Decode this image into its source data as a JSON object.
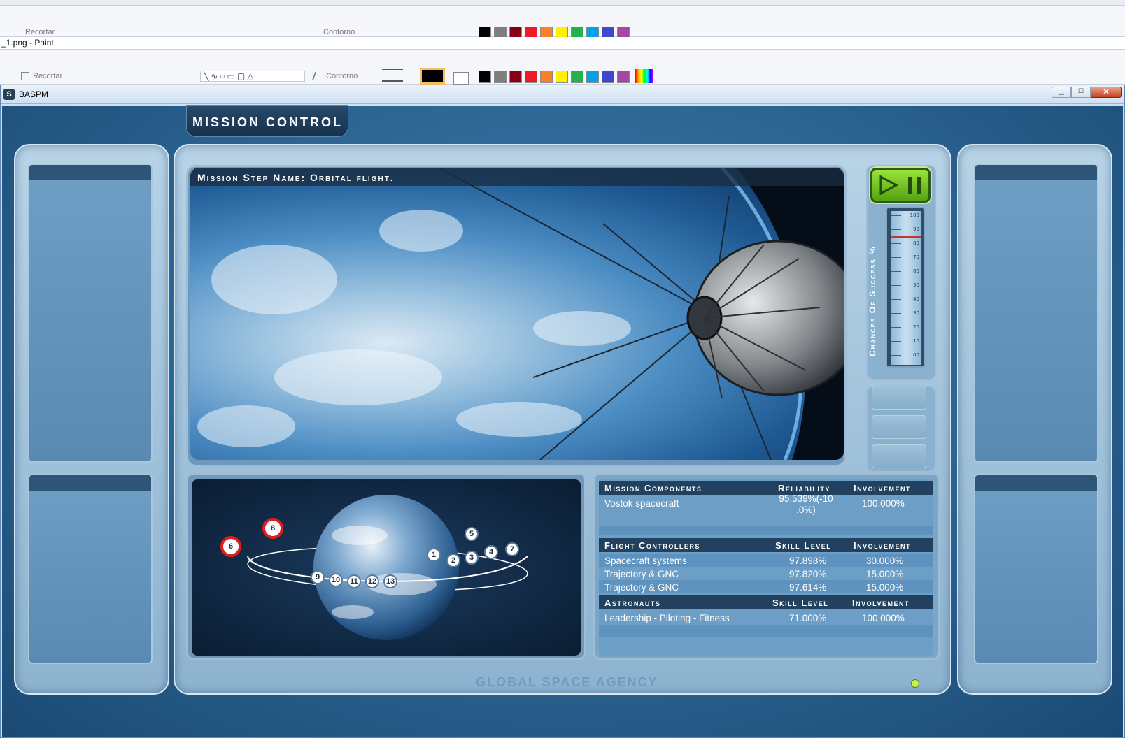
{
  "paint_top": {
    "crop_label": "Recortar",
    "outline_label": "Contorno",
    "palette": [
      "#000000",
      "#7f7f7f",
      "#880015",
      "#ed1c24",
      "#ff7f27",
      "#fff200",
      "#22b14c",
      "#00a2e8",
      "#3f48cc",
      "#a349a4"
    ]
  },
  "paint_window": {
    "title": "_1.png - Paint",
    "crop_label": "Recortar",
    "outline_label": "Contorno"
  },
  "app": {
    "title": "BASPM",
    "section_title": "MISSION CONTROL",
    "mission_step": "Mission Step Name: Orbital flight.",
    "gauge_label": "Chances Of Success %",
    "gauge_ticks": [
      "100",
      "90",
      "80",
      "70",
      "60",
      "50",
      "40",
      "30",
      "20",
      "10",
      "00"
    ],
    "gauge_marker_percent": 85,
    "footer": "GLOBAL SPACE AGENCY",
    "orbit_markers": [
      "1",
      "2",
      "3",
      "4",
      "5",
      "6",
      "7",
      "8",
      "9",
      "10",
      "11",
      "12",
      "13"
    ],
    "highlighted_markers": [
      "6",
      "8"
    ],
    "components": {
      "headers": [
        "Mission Components",
        "Reliability",
        "Involvement"
      ],
      "rows": [
        [
          "Vostok spacecraft",
          "95.539%(-10 .0%)",
          "100.000%"
        ]
      ]
    },
    "controllers": {
      "headers": [
        "Flight Controllers",
        "Skill Level",
        "Involvement"
      ],
      "rows": [
        [
          "Spacecraft systems",
          "97.898%",
          "30.000%"
        ],
        [
          "Trajectory & GNC",
          "97.820%",
          "15.000%"
        ],
        [
          "Trajectory & GNC",
          "97.614%",
          "15.000%"
        ]
      ]
    },
    "astronauts": {
      "headers": [
        "Astronauts",
        "Skill Level",
        "Involvement"
      ],
      "rows": [
        [
          "Leadership - Piloting - Fitness",
          "71.000%",
          "100.000%"
        ]
      ]
    }
  }
}
